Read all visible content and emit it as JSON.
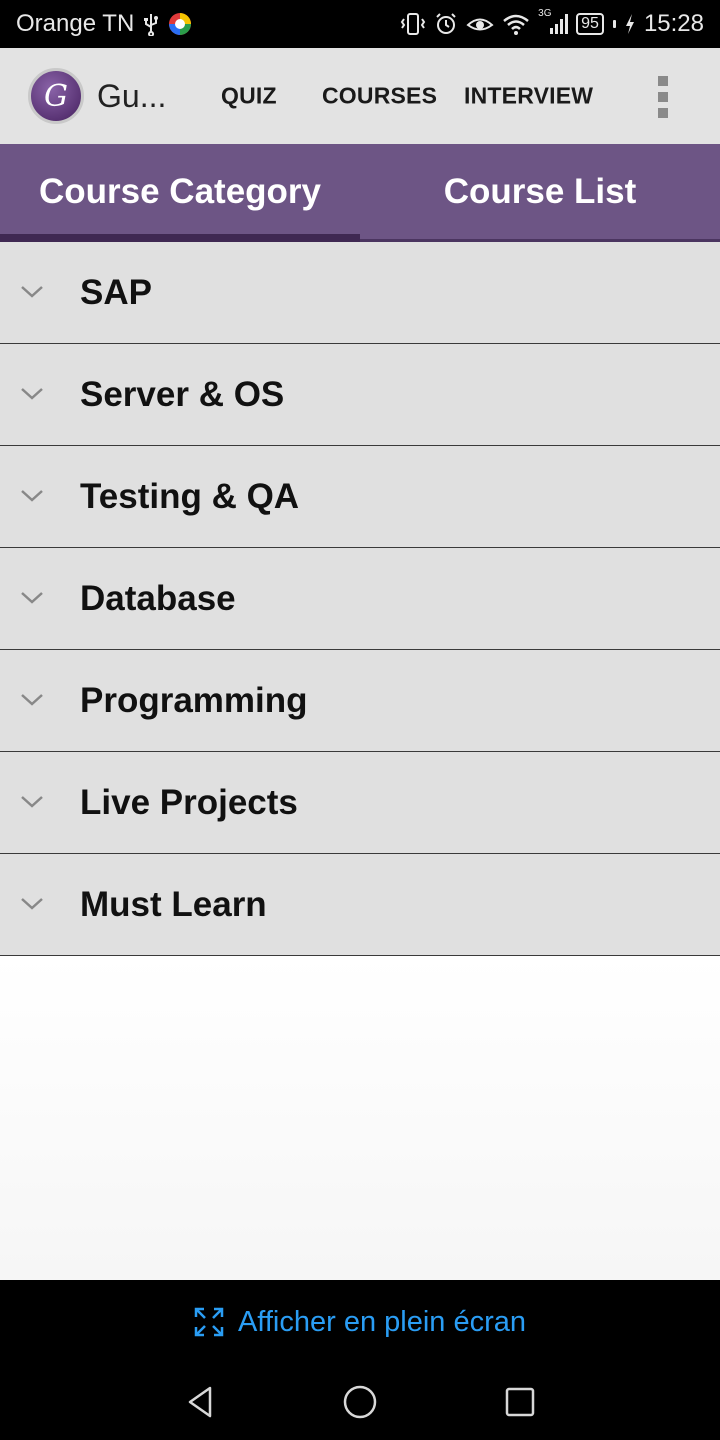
{
  "status_bar": {
    "carrier": "Orange TN",
    "battery": "95",
    "network": "3G",
    "time": "15:28"
  },
  "app_bar": {
    "title": "Gu...",
    "menu": [
      "QUIZ",
      "COURSES",
      "INTERVIEW"
    ]
  },
  "tabs": [
    "Course Category",
    "Course List"
  ],
  "categories": [
    "SAP",
    "Server & OS",
    "Testing & QA",
    "Database",
    "Programming",
    "Live Projects",
    "Must Learn"
  ],
  "fullscreen_prompt": "Afficher en plein écran",
  "colors": {
    "tab_bar": "#6d5585",
    "accent_blue": "#2a9df4",
    "list_bg": "#e0e0e0"
  }
}
